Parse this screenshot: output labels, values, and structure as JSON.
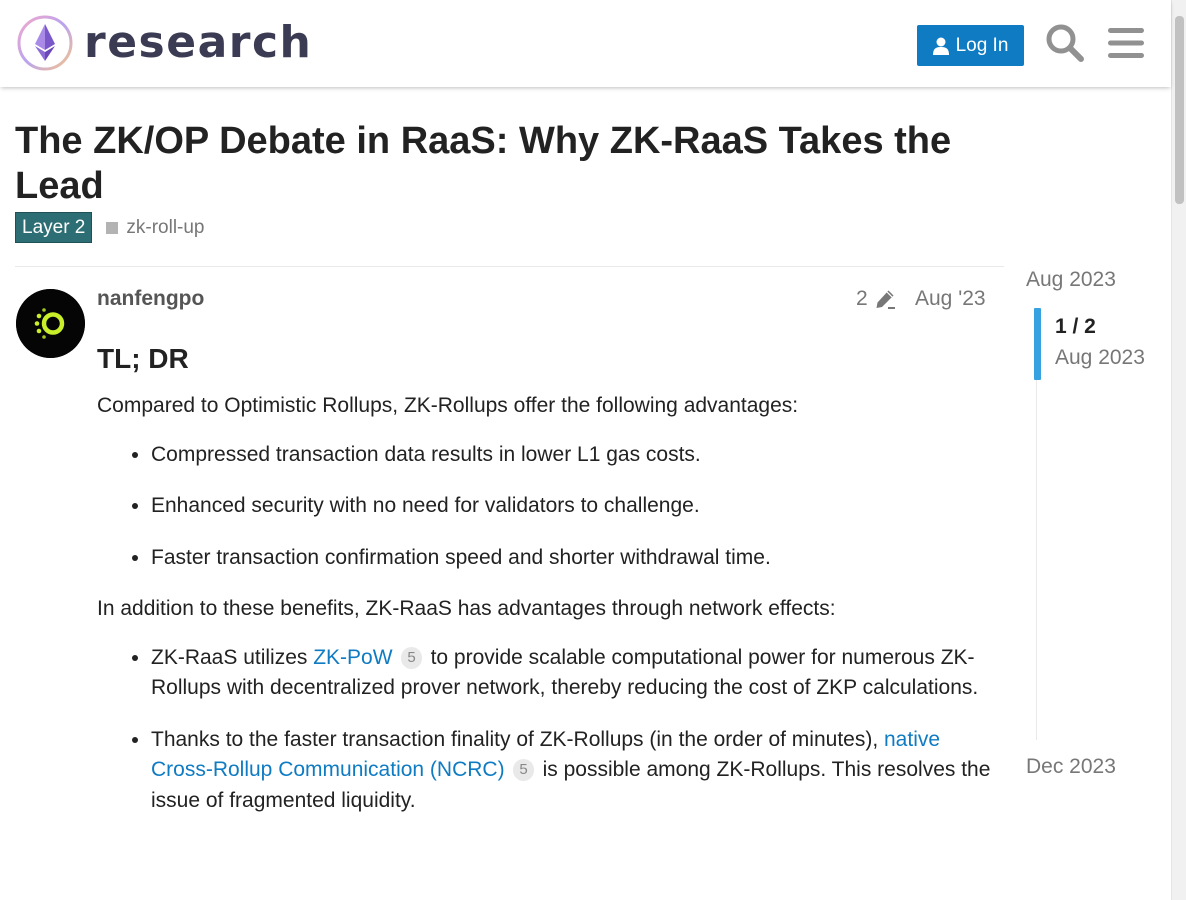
{
  "header": {
    "logo_text": "research",
    "login_label": "Log In"
  },
  "colors": {
    "accent": "#0f7bc2",
    "category": "#2d6e74",
    "timeline_handle": "#36a3e0"
  },
  "topic": {
    "title": "The ZK/OP Debate in RaaS: Why ZK-RaaS Takes the Lead",
    "category": "Layer 2",
    "tags": [
      "zk-roll-up"
    ]
  },
  "post": {
    "username": "nanfengpo",
    "edit_count": "2",
    "date": "Aug '23",
    "heading": "TL; DR",
    "intro": "Compared to Optimistic Rollups, ZK-Rollups offer the following advantages:",
    "advantages": [
      "Compressed transaction data results in lower L1 gas costs.",
      "Enhanced security with no need for validators to challenge.",
      "Faster transaction confirmation speed and shorter withdrawal time."
    ],
    "network_intro": "In addition to these benefits, ZK-RaaS has advantages through network effects:",
    "network_items": [
      {
        "before": "ZK-RaaS utilizes ",
        "link": "ZK-PoW",
        "clicks": "5",
        "after": " to provide scalable computational power for numerous ZK-Rollups with decentralized prover network, thereby reducing the cost of ZKP calculations."
      },
      {
        "before": "Thanks to the faster transaction finality of ZK-Rollups (in the order of minutes), ",
        "link": "native Cross-Rollup Communication (NCRC)",
        "clicks": "5",
        "after": " is possible among ZK-Rollups. This resolves the issue of fragmented liquidity."
      }
    ]
  },
  "timeline": {
    "top_date": "Aug 2023",
    "position": "1 / 2",
    "current_date": "Aug 2023",
    "bottom_date": "Dec 2023"
  }
}
